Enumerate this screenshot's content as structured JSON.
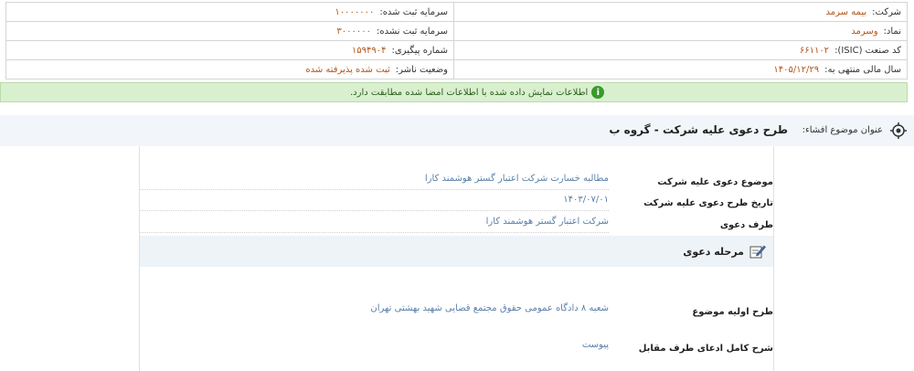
{
  "header": {
    "rows": [
      {
        "right": {
          "key": "شرکت:",
          "value": "بیمه سرمد"
        },
        "left": {
          "key": "سرمایه ثبت شده:",
          "value": "۱۰۰۰۰۰۰۰"
        }
      },
      {
        "right": {
          "key": "نماد:",
          "value": "وسرمد"
        },
        "left": {
          "key": "سرمایه ثبت نشده:",
          "value": "۳۰۰۰۰۰۰"
        }
      },
      {
        "right": {
          "key": "کد صنعت (ISIC):",
          "value": "۶۶۱۱۰۲"
        },
        "left": {
          "key": "شماره پیگیری:",
          "value": "۱۵۹۴۹۰۴"
        }
      },
      {
        "right": {
          "key": "سال مالی منتهی به:",
          "value": "۱۴۰۵/۱۲/۲۹"
        },
        "left": {
          "key": "وضعیت ناشر:",
          "value": "ثبت شده پذیرفته شده"
        }
      }
    ]
  },
  "banner": {
    "icon": "info-icon",
    "color": "#d9f0cf",
    "text": "اطلاعات نمایش داده شده با اطلاعات امضا شده مطابقت دارد."
  },
  "subject": {
    "label": "عنوان موضوع افشاء:",
    "title": "طرح دعوی علیه شرکت - گروه ب"
  },
  "details": [
    {
      "label": "موضوع دعوی علیه شرکت",
      "value": "مطالبه خسارت شرکت اعتبار گستر هوشمند کارا"
    },
    {
      "label": "تاریخ طرح دعوی علیه شرکت",
      "value": "۱۴۰۳/۰۷/۰۱"
    },
    {
      "label": "طرف دعوی",
      "value": "شرکت اعتبار گستر هوشمند کارا"
    }
  ],
  "section": {
    "title": "مرحله دعوی",
    "rows": [
      {
        "label": "طرح اولیه موضوع",
        "value": "شعبه ۸ دادگاه عمومی حقوق مجتمع قضایی شهید بهشتی تهران"
      },
      {
        "label": "شرح کامل ادعای طرف مقابل",
        "value": "پیوست"
      }
    ]
  }
}
